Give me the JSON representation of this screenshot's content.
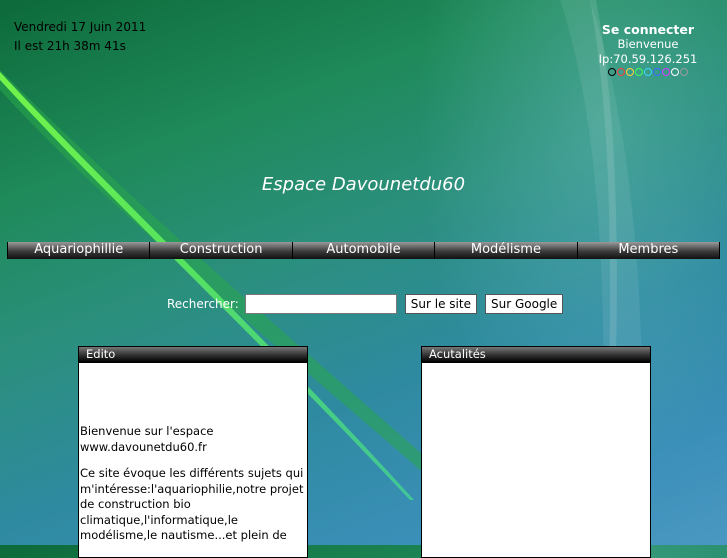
{
  "header": {
    "date": "Vendredi 17 Juin 2011",
    "time": "Il est 21h 38m 41s"
  },
  "login": {
    "connect_label": "Se connecter",
    "welcome": "Bienvenue",
    "ip": "Ip:70.59.126.251",
    "dot_colors": [
      "#000000",
      "#ff3b3b",
      "#ffd23b",
      "#3bff5a",
      "#3bd6ff",
      "#3b6bff",
      "#d43bff",
      "#ffffff",
      "#9a9a9a"
    ]
  },
  "site_title": "Espace Davounetdu60",
  "nav": {
    "items": [
      "Aquariophillie",
      "Construction",
      "Automobile",
      "Modélisme",
      "Membres"
    ]
  },
  "search": {
    "label": "Rechercher:",
    "value": "",
    "site_button": "Sur le site",
    "google_button": "Sur Google"
  },
  "edito": {
    "title": "Edito",
    "p1": " Bienvenue sur l'espace www.davounetdu60.fr",
    "p2": "Ce site évoque les différents sujets qui m'intéresse:l'aquariophilie,notre projet de construction bio climatique,l'informatique,le modélisme,le nautisme...et plein de"
  },
  "actus": {
    "title": "Acutalités"
  },
  "colors": {
    "nav_bg": "#3a3a3a",
    "panel_bg": "#ffffff",
    "title_text": "#ffffff"
  }
}
